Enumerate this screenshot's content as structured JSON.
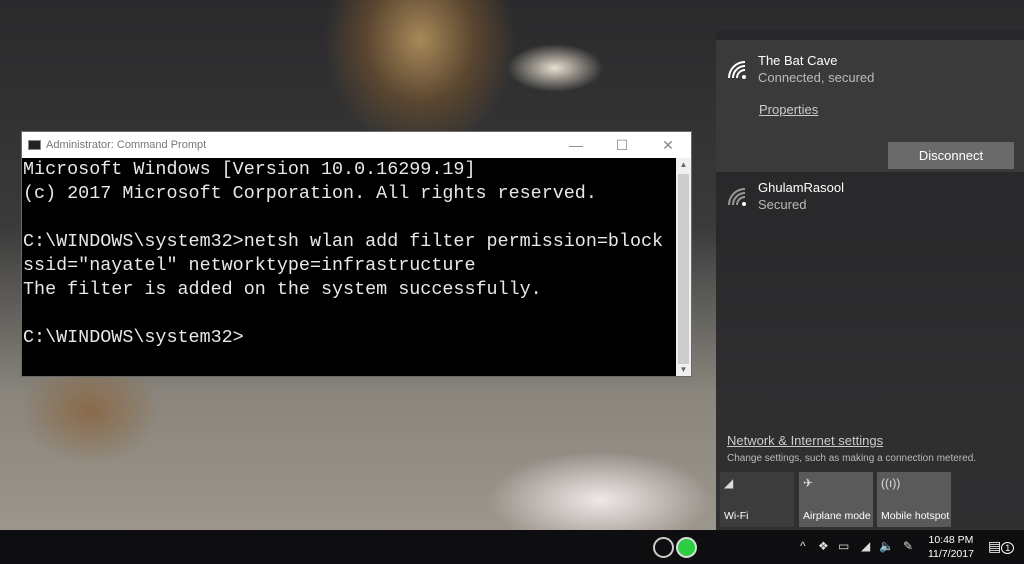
{
  "cmd": {
    "title": "Administrator: Command Prompt",
    "lines": [
      "Microsoft Windows [Version 10.0.16299.19]",
      "(c) 2017 Microsoft Corporation. All rights reserved.",
      "",
      "C:\\WINDOWS\\system32>netsh wlan add filter permission=block",
      "ssid=\"nayatel\" networktype=infrastructure",
      "The filter is added on the system successfully.",
      "",
      "C:\\WINDOWS\\system32>"
    ],
    "minimize": "—",
    "maximize": "☐",
    "close": "✕"
  },
  "network": {
    "connected": {
      "name": "The Bat Cave",
      "status": "Connected, secured",
      "properties": "Properties",
      "disconnect": "Disconnect"
    },
    "other": {
      "name": "GhulamRasool",
      "status": "Secured"
    },
    "settings_link": "Network & Internet settings",
    "settings_sub": "Change settings, such as making a connection metered.",
    "tiles": [
      {
        "label": "Wi-Fi",
        "icon": "wifi-icon"
      },
      {
        "label": "Airplane mode",
        "icon": "airplane-icon"
      },
      {
        "label": "Mobile hotspot",
        "icon": "hotspot-icon"
      }
    ]
  },
  "taskbar": {
    "time": "10:48 PM",
    "date": "11/7/2017",
    "notifications": "1"
  }
}
